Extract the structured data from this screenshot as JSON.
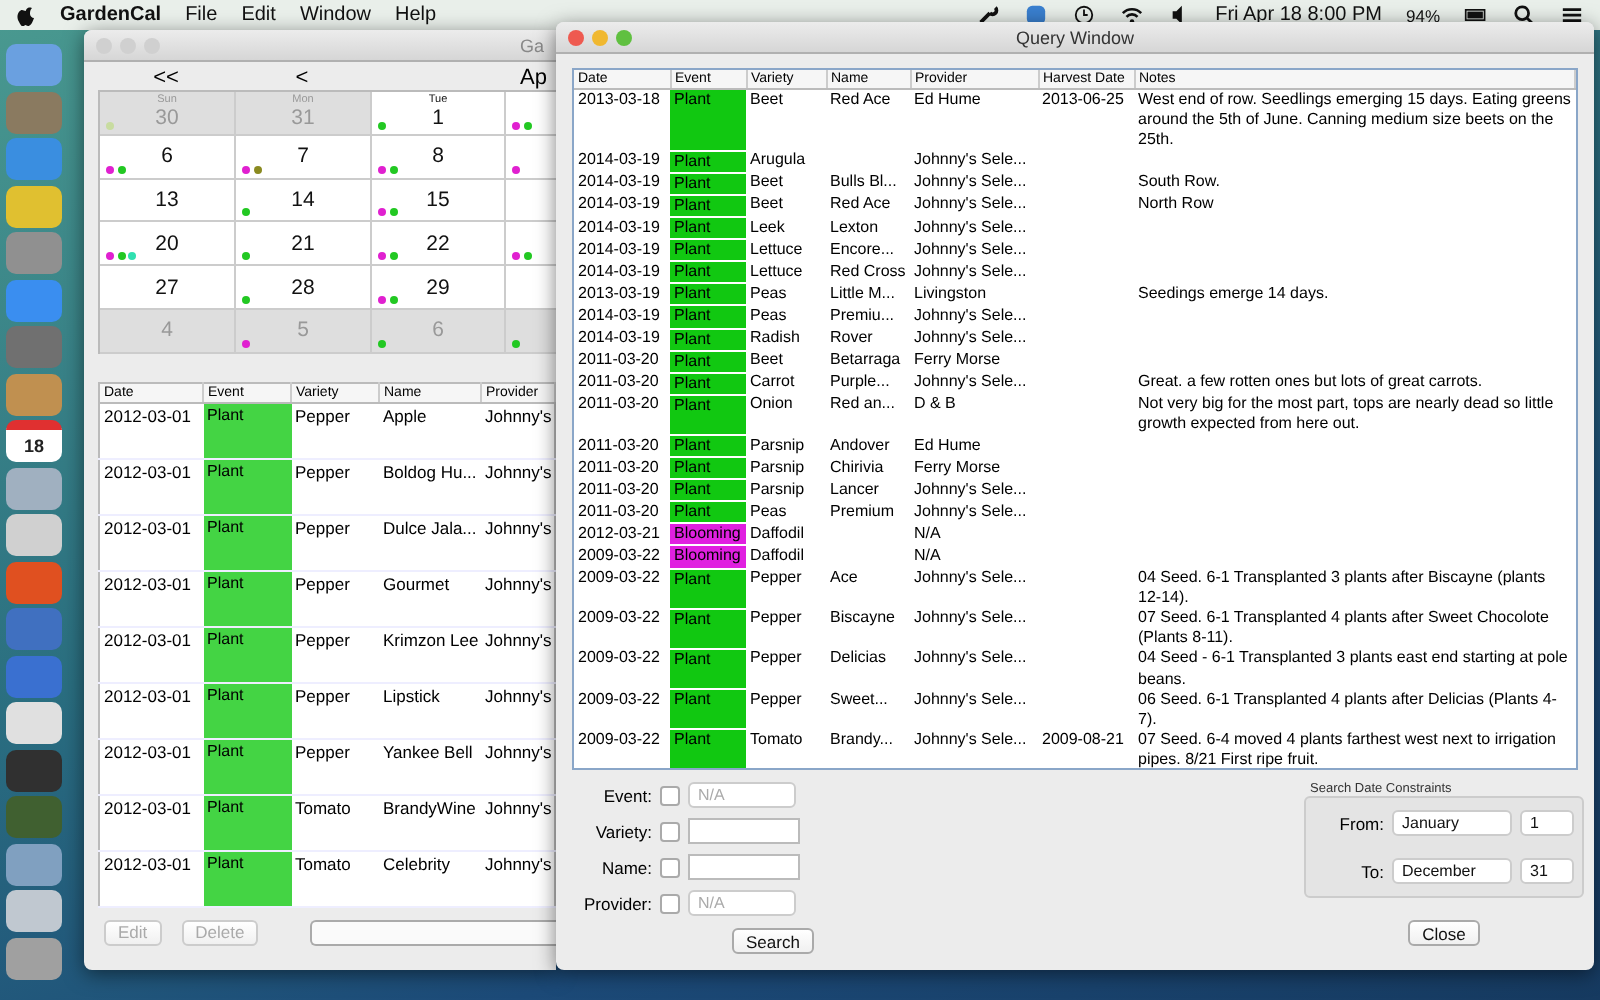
{
  "menu_bar": {
    "app": "GardenCal",
    "menus": [
      "File",
      "Edit",
      "Window",
      "Help"
    ],
    "clock": "Fri Apr 18  8:00 PM",
    "battery": "94%"
  },
  "dock": {
    "calendar_day": "18"
  },
  "main_window": {
    "title": "Ga",
    "nav": [
      "<<",
      "<"
    ],
    "month": "Ap",
    "calendar": {
      "weeks": [
        {
          "days": [
            {
              "weekday": "Sun",
              "day": "30",
              "in_month": false,
              "dots": [
                {
                  "color": "#c8dca0"
                }
              ]
            },
            {
              "weekday": "Mon",
              "day": "31",
              "in_month": false
            },
            {
              "weekday": "Tue",
              "day": "1",
              "in_month": true,
              "dots": [
                {
                  "color": "#22c822"
                }
              ]
            },
            {
              "in_month": true,
              "dots": [
                {
                  "color": "#e020d0"
                },
                {
                  "color": "#22c822"
                }
              ]
            }
          ]
        },
        {
          "days": [
            {
              "day": "6",
              "in_month": true,
              "dots": [
                {
                  "color": "#e020d0"
                },
                {
                  "color": "#22c822"
                }
              ]
            },
            {
              "day": "7",
              "in_month": true,
              "dots": [
                {
                  "color": "#e020d0"
                },
                {
                  "color": "#8a8a20"
                }
              ]
            },
            {
              "day": "8",
              "in_month": true,
              "dots": [
                {
                  "color": "#e020d0"
                },
                {
                  "color": "#22c822"
                }
              ]
            },
            {
              "in_month": true,
              "dots": [
                {
                  "color": "#e020d0"
                }
              ]
            }
          ]
        },
        {
          "days": [
            {
              "day": "13",
              "in_month": true
            },
            {
              "day": "14",
              "in_month": true,
              "dots": [
                {
                  "color": "#22c822"
                }
              ]
            },
            {
              "day": "15",
              "in_month": true,
              "dots": [
                {
                  "color": "#e020d0"
                },
                {
                  "color": "#22c822"
                }
              ]
            },
            {
              "in_month": true
            }
          ]
        },
        {
          "days": [
            {
              "day": "20",
              "in_month": true,
              "dots": [
                {
                  "color": "#e020d0"
                },
                {
                  "color": "#22c822"
                },
                {
                  "color": "#30e0b0"
                }
              ]
            },
            {
              "day": "21",
              "in_month": true,
              "dots": [
                {
                  "color": "#22c822"
                }
              ]
            },
            {
              "day": "22",
              "in_month": true,
              "dots": [
                {
                  "color": "#e020d0"
                },
                {
                  "color": "#22c822"
                }
              ]
            },
            {
              "in_month": true,
              "dots": [
                {
                  "color": "#e020d0"
                },
                {
                  "color": "#22c822"
                }
              ]
            }
          ]
        },
        {
          "days": [
            {
              "day": "27",
              "in_month": true
            },
            {
              "day": "28",
              "in_month": true,
              "dots": [
                {
                  "color": "#22c822"
                }
              ]
            },
            {
              "day": "29",
              "in_month": true,
              "dots": [
                {
                  "color": "#e020d0"
                },
                {
                  "color": "#22c822"
                }
              ]
            },
            {
              "in_month": true
            }
          ]
        },
        {
          "days": [
            {
              "day": "4",
              "in_month": false
            },
            {
              "day": "5",
              "in_month": false,
              "dots": [
                {
                  "color": "#e020d0"
                }
              ]
            },
            {
              "day": "6",
              "in_month": false,
              "dots": [
                {
                  "color": "#22c822"
                }
              ]
            },
            {
              "in_month": false,
              "dots": [
                {
                  "color": "#22c822"
                }
              ]
            }
          ]
        }
      ]
    },
    "table": {
      "columns": [
        "Date",
        "Event",
        "Variety",
        "Name",
        "Provider"
      ],
      "rows": [
        {
          "date": "2012-03-01",
          "event": "Plant",
          "color": "#44d444",
          "variety": "Pepper",
          "name": "Apple",
          "provider": "Johnny's"
        },
        {
          "date": "2012-03-01",
          "event": "Plant",
          "color": "#44d444",
          "variety": "Pepper",
          "name": "Boldog Hu...",
          "provider": "Johnny's"
        },
        {
          "date": "2012-03-01",
          "event": "Plant",
          "color": "#44d444",
          "variety": "Pepper",
          "name": "Dulce Jala...",
          "provider": "Johnny's"
        },
        {
          "date": "2012-03-01",
          "event": "Plant",
          "color": "#44d444",
          "variety": "Pepper",
          "name": "Gourmet",
          "provider": "Johnny's"
        },
        {
          "date": "2012-03-01",
          "event": "Plant",
          "color": "#44d444",
          "variety": "Pepper",
          "name": "Krimzon Lee",
          "provider": "Johnny's"
        },
        {
          "date": "2012-03-01",
          "event": "Plant",
          "color": "#44d444",
          "variety": "Pepper",
          "name": "Lipstick",
          "provider": "Johnny's"
        },
        {
          "date": "2012-03-01",
          "event": "Plant",
          "color": "#44d444",
          "variety": "Pepper",
          "name": "Yankee Bell",
          "provider": "Johnny's"
        },
        {
          "date": "2012-03-01",
          "event": "Plant",
          "color": "#44d444",
          "variety": "Tomato",
          "name": "BrandyWine",
          "provider": "Johnny's"
        },
        {
          "date": "2012-03-01",
          "event": "Plant",
          "color": "#44d444",
          "variety": "Tomato",
          "name": "Celebrity",
          "provider": "Johnny's"
        }
      ]
    },
    "buttons": [
      {
        "label": "Edit",
        "disabled": true
      },
      {
        "label": "Delete",
        "disabled": true
      }
    ]
  },
  "query_window": {
    "title": "Query Window",
    "table": {
      "columns": [
        "Date",
        "Event",
        "Variety",
        "Name",
        "Provider",
        "Harvest Date",
        "Notes"
      ],
      "rows": [
        {
          "date": "2013-03-18",
          "event": "Plant",
          "color": "#11c811",
          "variety": "Beet",
          "name": "Red Ace",
          "provider": "Ed Hume",
          "harvest": "2013-06-25",
          "notes": "West end of row. Seedlings emerging 15 days. Eating greens around the 5th of June. Canning medium size beets on the 25th."
        },
        {
          "date": "2014-03-19",
          "event": "Plant",
          "color": "#11c811",
          "variety": "Arugula",
          "provider": "Johnny's Sele..."
        },
        {
          "date": "2014-03-19",
          "event": "Plant",
          "color": "#11c811",
          "variety": "Beet",
          "name": "Bulls Bl...",
          "provider": "Johnny's Sele...",
          "notes": "South Row."
        },
        {
          "date": "2014-03-19",
          "event": "Plant",
          "color": "#11c811",
          "variety": "Beet",
          "name": "Red Ace",
          "provider": "Johnny's Sele...",
          "notes": "North Row"
        },
        {
          "date": "2014-03-19",
          "event": "Plant",
          "color": "#11c811",
          "variety": "Leek",
          "name": "Lexton",
          "provider": "Johnny's Sele..."
        },
        {
          "date": "2014-03-19",
          "event": "Plant",
          "color": "#11c811",
          "variety": "Lettuce",
          "name": "Encore...",
          "provider": "Johnny's Sele..."
        },
        {
          "date": "2014-03-19",
          "event": "Plant",
          "color": "#11c811",
          "variety": "Lettuce",
          "name": "Red Cross",
          "provider": "Johnny's Sele..."
        },
        {
          "date": "2013-03-19",
          "event": "Plant",
          "color": "#11c811",
          "variety": "Peas",
          "name": "Little M...",
          "provider": "Livingston",
          "notes": "Seedings emerge 14 days."
        },
        {
          "date": "2014-03-19",
          "event": "Plant",
          "color": "#11c811",
          "variety": "Peas",
          "name": "Premiu...",
          "provider": "Johnny's Sele..."
        },
        {
          "date": "2014-03-19",
          "event": "Plant",
          "color": "#11c811",
          "variety": "Radish",
          "name": "Rover",
          "provider": "Johnny's Sele..."
        },
        {
          "date": "2011-03-20",
          "event": "Plant",
          "color": "#11c811",
          "variety": "Beet",
          "name": "Betarraga",
          "provider": "Ferry Morse"
        },
        {
          "date": "2011-03-20",
          "event": "Plant",
          "color": "#11c811",
          "variety": "Carrot",
          "name": "Purple...",
          "provider": "Johnny's Sele...",
          "notes": "Great. a few rotten ones but lots of great carrots."
        },
        {
          "date": "2011-03-20",
          "event": "Plant",
          "color": "#11c811",
          "variety": "Onion",
          "name": "Red an...",
          "provider": "D & B",
          "notes": "Not very big for the most part, tops are nearly dead so little growth expected from here out."
        },
        {
          "date": "2011-03-20",
          "event": "Plant",
          "color": "#11c811",
          "variety": "Parsnip",
          "name": "Andover",
          "provider": "Ed Hume"
        },
        {
          "date": "2011-03-20",
          "event": "Plant",
          "color": "#11c811",
          "variety": "Parsnip",
          "name": "Chirivia",
          "provider": "Ferry Morse"
        },
        {
          "date": "2011-03-20",
          "event": "Plant",
          "color": "#11c811",
          "variety": "Parsnip",
          "name": "Lancer",
          "provider": "Johnny's Sele..."
        },
        {
          "date": "2011-03-20",
          "event": "Plant",
          "color": "#11c811",
          "variety": "Peas",
          "name": "Premium",
          "provider": "Johnny's Sele..."
        },
        {
          "date": "2012-03-21",
          "event": "Blooming",
          "color": "#e020e0",
          "variety": "Daffodil",
          "provider": "N/A"
        },
        {
          "date": "2009-03-22",
          "event": "Blooming",
          "color": "#e020e0",
          "variety": "Daffodil",
          "provider": "N/A"
        },
        {
          "date": "2009-03-22",
          "event": "Plant",
          "color": "#11c811",
          "variety": "Pepper",
          "name": "Ace",
          "provider": "Johnny's Sele...",
          "notes": "04 Seed. 6-1 Transplanted 3 plants after Biscayne (plants 12-14)."
        },
        {
          "date": "2009-03-22",
          "event": "Plant",
          "color": "#11c811",
          "variety": "Pepper",
          "name": "Biscayne",
          "provider": "Johnny's Sele...",
          "notes": "07 Seed. 6-1 Transplanted 4 plants after Sweet Chocolote (Plants 8-11)."
        },
        {
          "date": "2009-03-22",
          "event": "Plant",
          "color": "#11c811",
          "variety": "Pepper",
          "name": "Delicias",
          "provider": "Johnny's Sele...",
          "notes": "04 Seed - 6-1 Transplanted 3 plants east end starting at pole beans."
        },
        {
          "date": "2009-03-22",
          "event": "Plant",
          "color": "#11c811",
          "variety": "Pepper",
          "name": "Sweet...",
          "provider": "Johnny's Sele...",
          "notes": "06 Seed. 6-1 Transplanted 4 plants after Delicias (Plants 4-7)."
        },
        {
          "date": "2009-03-22",
          "event": "Plant",
          "color": "#11c811",
          "variety": "Tomato",
          "name": "Brandy...",
          "provider": "Johnny's Sele...",
          "harvest": "2009-08-21",
          "notes": "07 Seed. 6-4 moved 4 plants farthest west next to irrigation pipes. 8/21 First ripe fruit."
        }
      ]
    },
    "filters": [
      {
        "label": "Event:",
        "checked": false,
        "kind": "popup",
        "value": "N/A",
        "disabled": true
      },
      {
        "label": "Variety:",
        "checked": false,
        "kind": "text"
      },
      {
        "label": "Name:",
        "checked": false,
        "kind": "text"
      },
      {
        "label": "Provider:",
        "checked": false,
        "kind": "popup",
        "value": "N/A",
        "disabled": true
      }
    ],
    "search_button": "Search",
    "date_constraints": {
      "title": "Search Date Constraints",
      "rows": [
        {
          "label": "From:",
          "month": "January",
          "day": "1"
        },
        {
          "label": "To:",
          "month": "December",
          "day": "31"
        }
      ]
    },
    "close_button": "Close"
  }
}
